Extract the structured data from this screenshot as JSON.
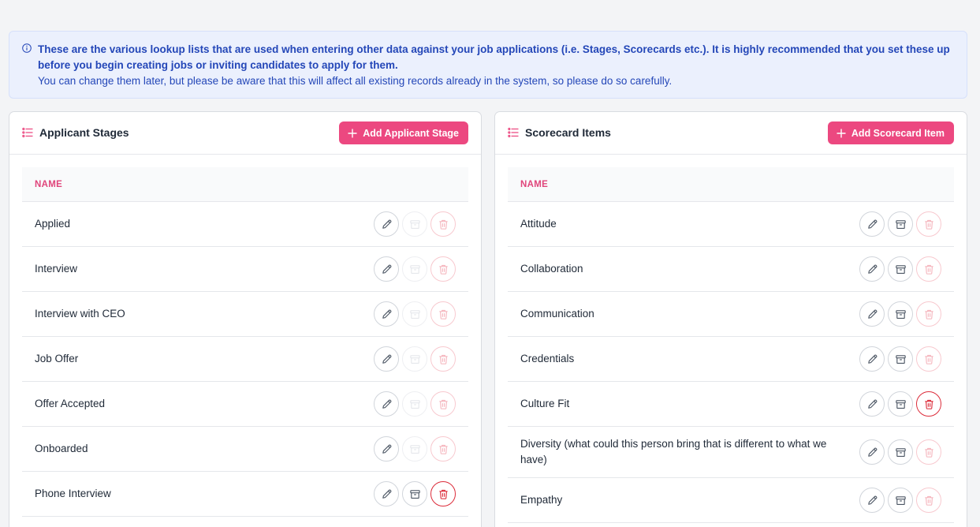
{
  "info": {
    "bold_text": "These are the various lookup lists that are used when entering other data against your job applications (i.e. Stages, Scorecards etc.). It is highly recommended that you set these up before you begin creating jobs or inviting candidates to apply for them.",
    "normal_text": "You can change them later, but please be aware that this will affect all existing records already in the system, so please do so carefully."
  },
  "applicant_stages": {
    "title": "Applicant Stages",
    "add_label": "Add Applicant Stage",
    "column_name": "NAME",
    "rows": [
      {
        "name": "Applied",
        "archive": "disabled",
        "delete": "disabled"
      },
      {
        "name": "Interview",
        "archive": "disabled",
        "delete": "disabled"
      },
      {
        "name": "Interview with CEO",
        "archive": "disabled",
        "delete": "disabled"
      },
      {
        "name": "Job Offer",
        "archive": "disabled",
        "delete": "disabled"
      },
      {
        "name": "Offer Accepted",
        "archive": "disabled",
        "delete": "disabled"
      },
      {
        "name": "Onboarded",
        "archive": "disabled",
        "delete": "disabled"
      },
      {
        "name": "Phone Interview",
        "archive": "enabled",
        "delete": "enabled"
      }
    ]
  },
  "scorecard_items": {
    "title": "Scorecard Items",
    "add_label": "Add Scorecard Item",
    "column_name": "NAME",
    "rows": [
      {
        "name": "Attitude",
        "archive": "enabled",
        "delete": "disabled"
      },
      {
        "name": "Collaboration",
        "archive": "enabled",
        "delete": "disabled"
      },
      {
        "name": "Communication",
        "archive": "enabled",
        "delete": "disabled"
      },
      {
        "name": "Credentials",
        "archive": "enabled",
        "delete": "disabled"
      },
      {
        "name": "Culture Fit",
        "archive": "enabled",
        "delete": "enabled"
      },
      {
        "name": "Diversity (what could this person bring that is different to what we have)",
        "archive": "enabled",
        "delete": "disabled"
      },
      {
        "name": "Empathy",
        "archive": "enabled",
        "delete": "disabled"
      }
    ]
  },
  "colors": {
    "accent": "#ec4880",
    "info_bg": "#ebf0fd",
    "info_text": "#2447b8",
    "delete_red": "#dc2c3a"
  },
  "icons": {
    "info": "info-icon",
    "list": "list-icon",
    "add": "plus-icon",
    "edit": "pencil-icon",
    "archive": "archive-icon",
    "delete": "trash-icon"
  }
}
